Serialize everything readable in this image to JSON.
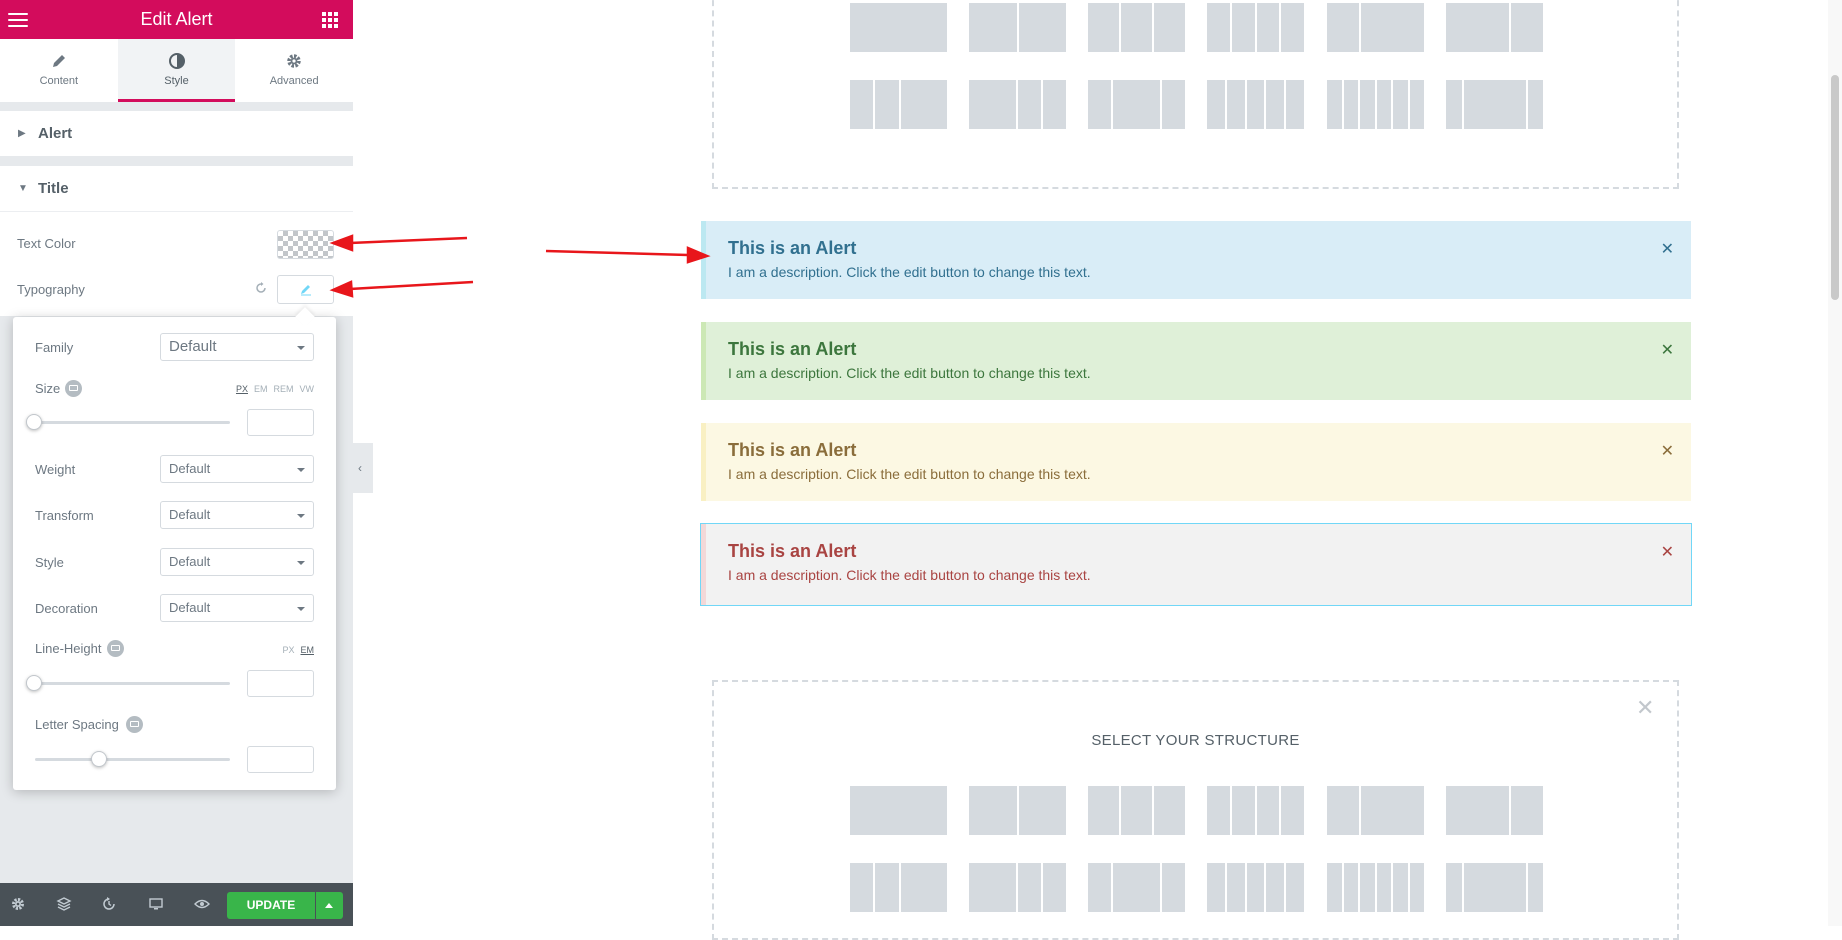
{
  "sidebar": {
    "title": "Edit Alert",
    "tabs": [
      {
        "label": "Content",
        "icon": "pencil-icon"
      },
      {
        "label": "Style",
        "icon": "contrast-icon"
      },
      {
        "label": "Advanced",
        "icon": "gear-icon"
      }
    ],
    "active_tab": "Style",
    "sections": {
      "alert": "Alert",
      "title": "Title"
    },
    "controls": {
      "text_color_label": "Text Color",
      "typography_label": "Typography"
    },
    "typography": {
      "family_label": "Family",
      "family_value": "Default",
      "size_label": "Size",
      "size_units": [
        "PX",
        "EM",
        "REM",
        "VW"
      ],
      "size_unit_selected": "PX",
      "weight_label": "Weight",
      "weight_value": "Default",
      "transform_label": "Transform",
      "transform_value": "Default",
      "style_label": "Style",
      "style_value": "Default",
      "decoration_label": "Decoration",
      "decoration_value": "Default",
      "line_height_label": "Line-Height",
      "line_height_units": [
        "PX",
        "EM"
      ],
      "line_height_unit_selected": "EM",
      "letter_spacing_label": "Letter Spacing"
    },
    "footer": {
      "update_label": "UPDATE"
    }
  },
  "canvas": {
    "select_structure": "SELECT YOUR STRUCTURE",
    "alerts": [
      {
        "title": "This is an Alert",
        "description": "I am a description. Click the edit button to change this text.",
        "type": "info"
      },
      {
        "title": "This is an Alert",
        "description": "I am a description. Click the edit button to change this text.",
        "type": "success"
      },
      {
        "title": "This is an Alert",
        "description": "I am a description. Click the edit button to change this text.",
        "type": "warning"
      },
      {
        "title": "This is an Alert",
        "description": "I am a description. Click the edit button to change this text.",
        "type": "danger"
      }
    ]
  },
  "colors": {
    "brand": "#d30c5c",
    "update": "#39b54a",
    "annotation_arrow": "#e8161b",
    "info_bg": "#d9edf7",
    "info_text": "#31708f",
    "info_border": "#bce8f1",
    "success_bg": "#dff0d8",
    "success_text": "#3c763d",
    "success_border": "#cce8b5",
    "warning_bg": "#fcf8e3",
    "warning_text": "#8a6d3b",
    "warning_border": "#f9f0c3",
    "danger_bg": "#f2f2f2",
    "danger_text": "#a94442",
    "danger_border": "#f3d8d8"
  }
}
